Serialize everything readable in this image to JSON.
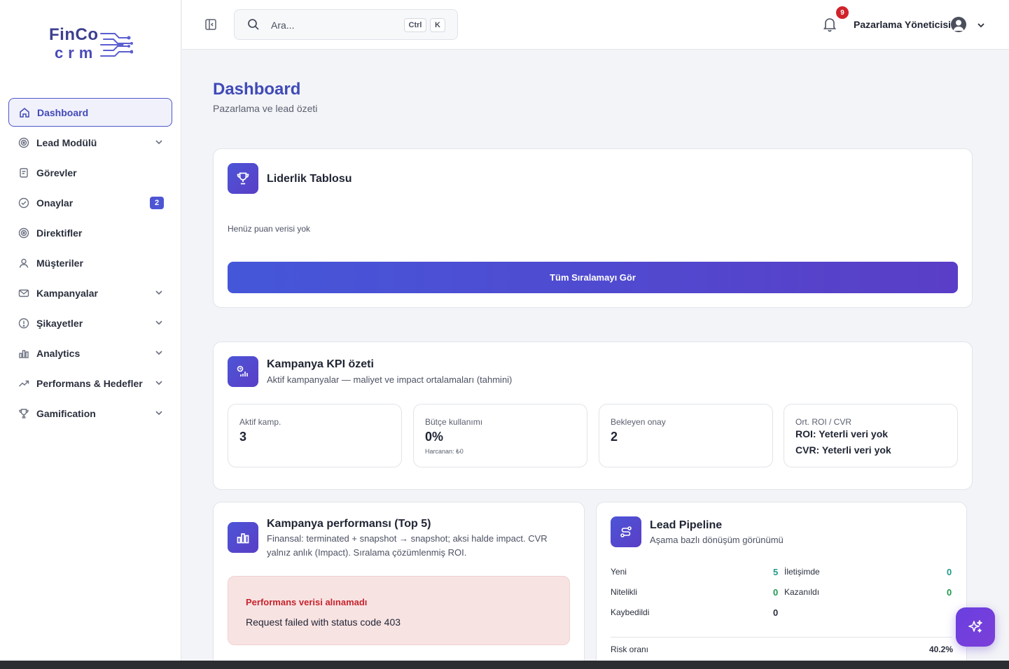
{
  "brand": {
    "line1": "FinCo",
    "line2": "crm"
  },
  "sidebar": {
    "items": [
      {
        "label": "Dashboard",
        "icon": "home-icon",
        "active": true
      },
      {
        "label": "Lead Modülü",
        "icon": "target-icon",
        "expandable": true
      },
      {
        "label": "Görevler",
        "icon": "clipboard-icon"
      },
      {
        "label": "Onaylar",
        "icon": "check-circle-icon",
        "badge": "2"
      },
      {
        "label": "Direktifler",
        "icon": "target-icon"
      },
      {
        "label": "Müşteriler",
        "icon": "user-icon"
      },
      {
        "label": "Kampanyalar",
        "icon": "mail-icon",
        "expandable": true
      },
      {
        "label": "Şikayetler",
        "icon": "alert-circle-icon",
        "expandable": true
      },
      {
        "label": "Analytics",
        "icon": "bar-chart-icon",
        "expandable": true
      },
      {
        "label": "Performans & Hedefler",
        "icon": "trending-up-icon",
        "expandable": true
      },
      {
        "label": "Gamification",
        "icon": "trophy-icon",
        "expandable": true
      }
    ]
  },
  "topbar": {
    "search_placeholder": "Ara...",
    "shortcut_ctrl": "Ctrl",
    "shortcut_key": "K",
    "notification_count": "9",
    "user_name": "Pazarlama Yöneticisi"
  },
  "page": {
    "title": "Dashboard",
    "subtitle": "Pazarlama ve lead özeti"
  },
  "leaderboard": {
    "title": "Liderlik Tablosu",
    "empty_text": "Henüz puan verisi yok",
    "button_label": "Tüm Sıralamayı Gör"
  },
  "kpi": {
    "title": "Kampanya KPI özeti",
    "subtitle": "Aktif kampanyalar — maliyet ve impact ortalamaları (tahmini)",
    "cards": [
      {
        "label": "Aktif kamp.",
        "value": "3"
      },
      {
        "label": "Bütçe kullanımı",
        "value": "0%",
        "note": "Harcanan: ₺0"
      },
      {
        "label": "Bekleyen onay",
        "value": "2"
      },
      {
        "label": "Ort. ROI / CVR",
        "line1": "ROI: Yeterli veri yok",
        "line2": "CVR: Yeterli veri yok"
      }
    ]
  },
  "performance": {
    "title": "Kampanya performansı (Top 5)",
    "subtitle_line1": "Finansal: terminated + snapshot → snapshot; aksi halde impact. CVR",
    "subtitle_line2": "yalnız anlık (Impact). Sıralama çözümlenmiş ROI.",
    "error_title": "Performans verisi alınamadı",
    "error_message": "Request failed with status code 403"
  },
  "pipeline": {
    "title": "Lead Pipeline",
    "subtitle": "Aşama bazlı dönüşüm görünümü",
    "rows": [
      {
        "label": "Yeni",
        "value": "5"
      },
      {
        "label": "İletişimde",
        "value": "0"
      },
      {
        "label": "Nitelikli",
        "value": "0"
      },
      {
        "label": "Kazanıldı",
        "value": "0"
      },
      {
        "label": "Kaybedildi",
        "value": "0"
      }
    ],
    "risk_label": "Risk oranı",
    "risk_value": "40.2%"
  },
  "colors": {
    "accent": "#4e55d4",
    "title_blue": "#3f4ab8",
    "error_red": "#c5242c",
    "teal": "#1f9a8a",
    "green": "#1d9a4d"
  }
}
